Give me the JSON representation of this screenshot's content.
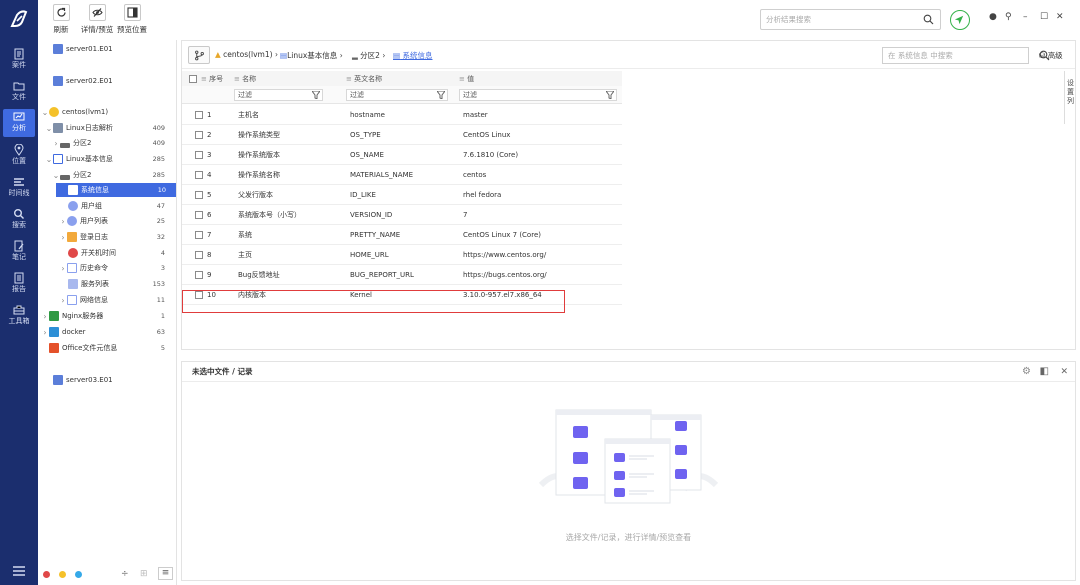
{
  "toolbar": {
    "refresh": "刷新",
    "detail_preview": "详情/预览",
    "preview_pos": "预览位置"
  },
  "rail": [
    {
      "label": "案件",
      "icon": "case-icon"
    },
    {
      "label": "文件",
      "icon": "folder-icon"
    },
    {
      "label": "分析",
      "icon": "analysis-icon",
      "active": true
    },
    {
      "label": "位置",
      "icon": "location-icon"
    },
    {
      "label": "时间线",
      "icon": "timeline-icon"
    },
    {
      "label": "搜索",
      "icon": "search-icon"
    },
    {
      "label": "笔记",
      "icon": "note-icon"
    },
    {
      "label": "报告",
      "icon": "report-icon"
    },
    {
      "label": "工具箱",
      "icon": "toolbox-icon"
    }
  ],
  "search": {
    "placeholder": "分析结果搜索"
  },
  "tree": {
    "server01": "server01.E01",
    "server02": "server02.E01",
    "centos": "centos(lvm1)",
    "linux_log": {
      "label": "Linux日志解析",
      "count": "409"
    },
    "partition_a": {
      "label": "分区2",
      "count": "409"
    },
    "linux_basic": {
      "label": "Linux基本信息",
      "count": "285"
    },
    "partition_b": {
      "label": "分区2",
      "count": "285"
    },
    "sysinfo": {
      "label": "系统信息",
      "count": "10"
    },
    "usergroup": {
      "label": "用户组",
      "count": "47"
    },
    "userlist": {
      "label": "用户列表",
      "count": "25"
    },
    "login": {
      "label": "登录日志",
      "count": "32"
    },
    "boot": {
      "label": "开关机时间",
      "count": "4"
    },
    "history": {
      "label": "历史命令",
      "count": "3"
    },
    "services": {
      "label": "服务列表",
      "count": "153"
    },
    "network": {
      "label": "网络信息",
      "count": "11"
    },
    "nginx": {
      "label": "Nginx服务器",
      "count": "1"
    },
    "docker": {
      "label": "docker",
      "count": "63"
    },
    "office": {
      "label": "Office文件元信息",
      "count": "5"
    },
    "server03": "server03.E01"
  },
  "breadcrumb": {
    "root": "centos(lvm1)",
    "mid": "Linux基本信息",
    "part": "分区2",
    "current": "系统信息"
  },
  "search2": {
    "placeholder": "在 系统信息 中搜索"
  },
  "advanced": "高级",
  "table": {
    "headers": {
      "index": "序号",
      "name": "名称",
      "en_name": "英文名称",
      "value": "值"
    },
    "filter": "过滤",
    "rows": [
      {
        "idx": "1",
        "name": "主机名",
        "en": "hostname",
        "val": "master"
      },
      {
        "idx": "2",
        "name": "操作系统类型",
        "en": "OS_TYPE",
        "val": "CentOS Linux"
      },
      {
        "idx": "3",
        "name": "操作系统版本",
        "en": "OS_NAME",
        "val": "7.6.1810 (Core)"
      },
      {
        "idx": "4",
        "name": "操作系统名称",
        "en": "MATERIALS_NAME",
        "val": "centos"
      },
      {
        "idx": "5",
        "name": "父发行版本",
        "en": "ID_LIKE",
        "val": "rhel fedora"
      },
      {
        "idx": "6",
        "name": "系统版本号（小写）",
        "en": "VERSION_ID",
        "val": "7"
      },
      {
        "idx": "7",
        "name": "系统",
        "en": "PRETTY_NAME",
        "val": "CentOS Linux 7 (Core)"
      },
      {
        "idx": "8",
        "name": "主页",
        "en": "HOME_URL",
        "val": "https://www.centos.org/"
      },
      {
        "idx": "9",
        "name": "Bug反馈地址",
        "en": "BUG_REPORT_URL",
        "val": "https://bugs.centos.org/"
      },
      {
        "idx": "10",
        "name": "内核版本",
        "en": "Kernel",
        "val": "3.10.0-957.el7.x86_64"
      }
    ]
  },
  "side_tag": "设置列",
  "panel2": {
    "title": "未选中文件 / 记录",
    "empty": "选择文件/记录，进行详情/预览查看"
  }
}
